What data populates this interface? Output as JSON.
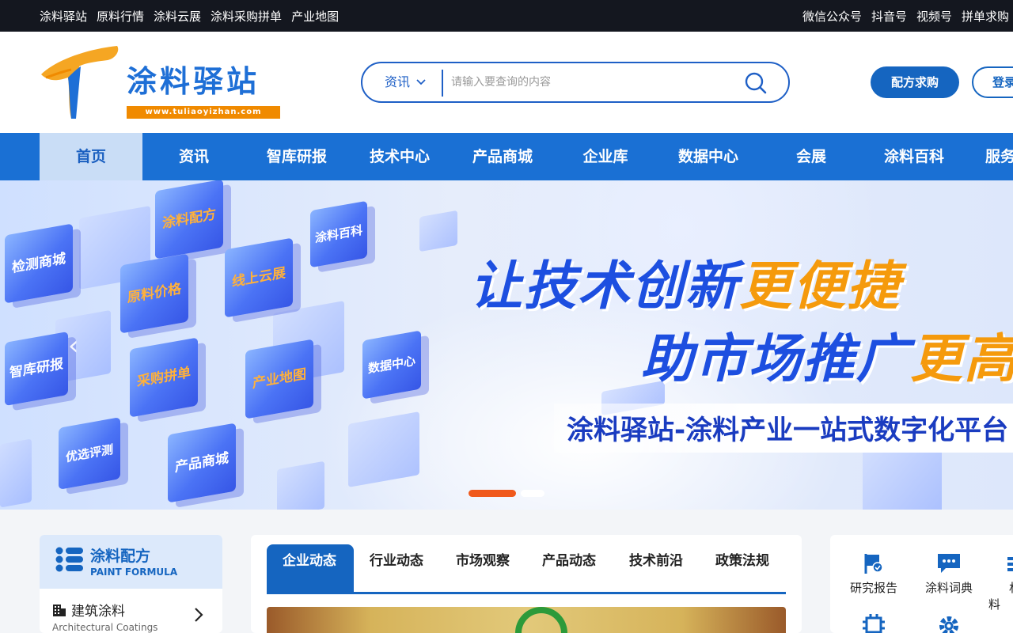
{
  "topbar": {
    "left_links": [
      "涂料驿站",
      "原料行情",
      "涂料云展",
      "涂料采购拼单",
      "产业地图"
    ],
    "right_links": [
      "微信公众号",
      "抖音号",
      "视频号",
      "拼单求购"
    ]
  },
  "header": {
    "logo_text": "涂料驿站",
    "logo_url": "www.tuliaoyizhan.com",
    "search": {
      "category": "资讯",
      "placeholder": "请输入要查询的内容"
    },
    "formula_button": "配方求购",
    "login_button": "登录"
  },
  "nav": {
    "items": [
      "首页",
      "资讯",
      "智库研报",
      "技术中心",
      "产品商城",
      "企业库",
      "数据中心",
      "会展",
      "涂料百科",
      "服务"
    ],
    "active": "首页"
  },
  "banner": {
    "cubes": [
      "涂料配方",
      "涂料百科",
      "检测商城",
      "原料价格",
      "线上云展",
      "智库研报",
      "采购拼单",
      "产业地图",
      "数据中心",
      "优选评测",
      "产品商城"
    ],
    "slogan_line1_main": "让技术创新",
    "slogan_line1_highlight": "更便捷",
    "slogan_line2_main": "助市场推广",
    "slogan_line2_highlight": "更高",
    "slogan_line3": "涂料驿站-涂料产业一站式数字化平台",
    "slide_count": 2,
    "active_slide": 1
  },
  "left_panel": {
    "title": "涂料配方",
    "subtitle": "PAINT FORMULA",
    "item_label": "建筑涂料",
    "item_en": "Architectural Coatings"
  },
  "mid_panel": {
    "tabs": [
      "企业动态",
      "行业动态",
      "市场观察",
      "产品动态",
      "技术前沿",
      "政策法规"
    ],
    "active_tab": "企业动态"
  },
  "right_panel": {
    "tools": [
      "研究报告",
      "涂料词典",
      "材料"
    ]
  },
  "colors": {
    "primary": "#1a70d4",
    "dark_topbar": "#14171f",
    "accent_orange": "#f59a0c",
    "active_dot": "#f0591c"
  }
}
